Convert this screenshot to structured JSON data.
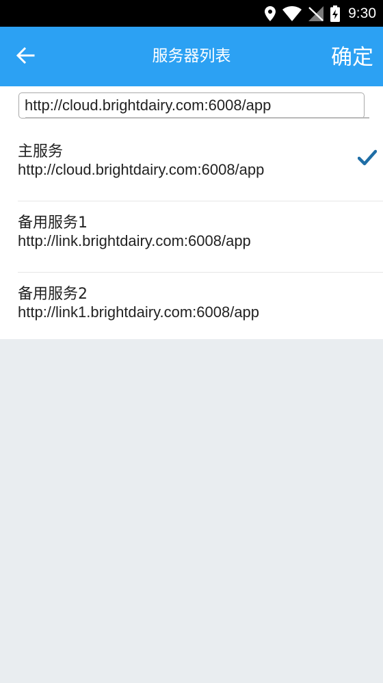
{
  "status_bar": {
    "time": "9:30",
    "icons": [
      "location-icon",
      "wifi-icon",
      "no-signal-icon",
      "battery-charging-icon"
    ]
  },
  "app_bar": {
    "back_icon": "arrow-left-icon",
    "title": "服务器列表",
    "confirm_label": "确定"
  },
  "server_input": {
    "value": "http://cloud.brightdairy.com:6008/app"
  },
  "servers": [
    {
      "name": "主服务",
      "url": "http://cloud.brightdairy.com:6008/app",
      "selected": true
    },
    {
      "name": "备用服务1",
      "url": "http://link.brightdairy.com:6008/app",
      "selected": false
    },
    {
      "name": "备用服务2",
      "url": "http://link1.brightdairy.com:6008/app",
      "selected": false
    }
  ],
  "colors": {
    "app_bar": "#2ca1f3",
    "check": "#1f6ea6",
    "background": "#e9edf0"
  }
}
